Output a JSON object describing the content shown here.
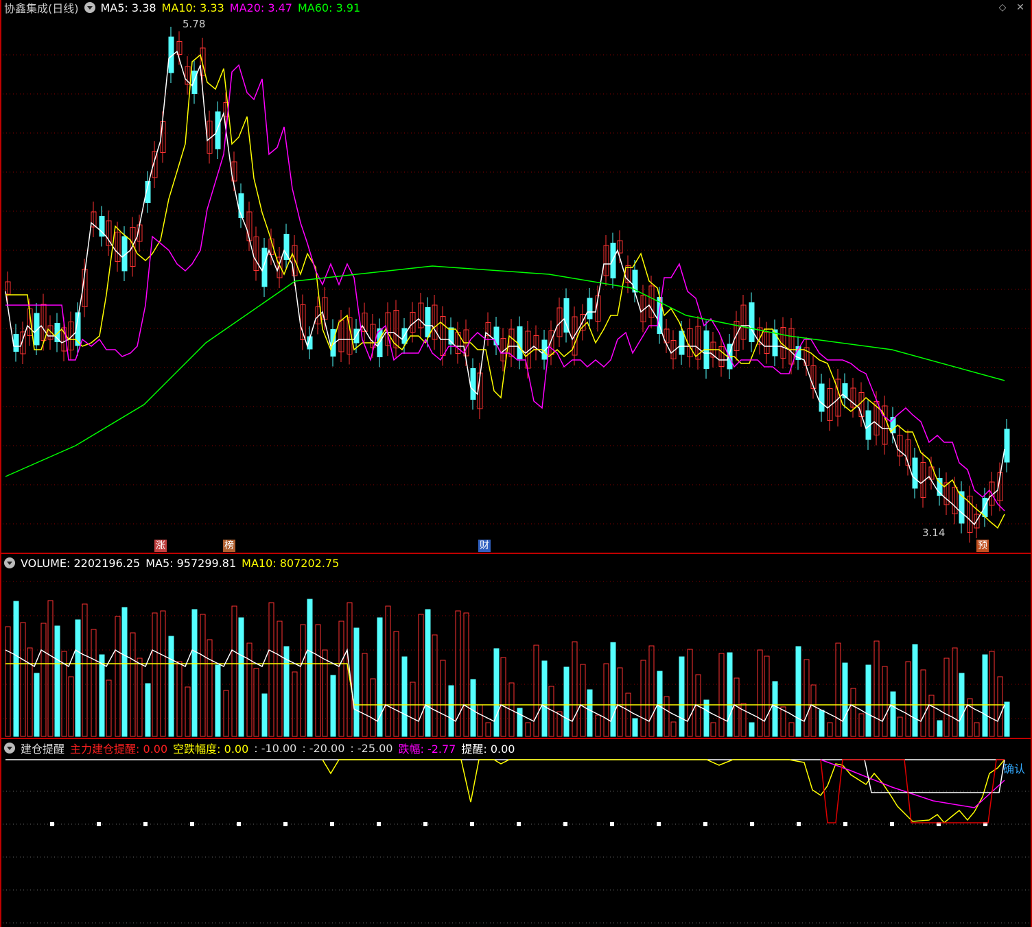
{
  "main": {
    "title": "协鑫集成(日线)",
    "ma5": {
      "label": "MA5:",
      "value": "3.38",
      "color": "#ffffff"
    },
    "ma10": {
      "label": "MA10:",
      "value": "3.33",
      "color": "#ffff00"
    },
    "ma20": {
      "label": "MA20:",
      "value": "3.47",
      "color": "#ff00ff"
    },
    "ma60": {
      "label": "MA60:",
      "value": "3.91",
      "color": "#00ff00"
    },
    "high_label": "5.78",
    "low_label": "3.14",
    "tags": [
      {
        "text": "涨",
        "bg": "#c04040"
      },
      {
        "text": "榜",
        "bg": "#b06030"
      },
      {
        "text": "财",
        "bg": "#3060c0"
      },
      {
        "text": "预",
        "bg": "#c05020"
      }
    ]
  },
  "volume": {
    "vol": {
      "label": "VOLUME:",
      "value": "2202196.25"
    },
    "ma5": {
      "label": "MA5:",
      "value": "957299.81"
    },
    "ma10": {
      "label": "MA10:",
      "value": "807202.75"
    }
  },
  "indicator": {
    "name": "建仓提醒",
    "zl": {
      "label": "主力建仓提醒:",
      "value": "0.00"
    },
    "kd": {
      "label": "空跌幅度:",
      "value": "0.00"
    },
    "lv1": ": -10.00",
    "lv2": ": -20.00",
    "lv3": ": -25.00",
    "df": {
      "label": "跌幅:",
      "value": "-2.77"
    },
    "tx": {
      "label": "提醒:",
      "value": "0.00"
    },
    "confirm": "确认"
  },
  "colors": {
    "up": "#ff3232",
    "down": "#54ffff",
    "grid": "#8b0000",
    "border": "#c00000"
  }
}
